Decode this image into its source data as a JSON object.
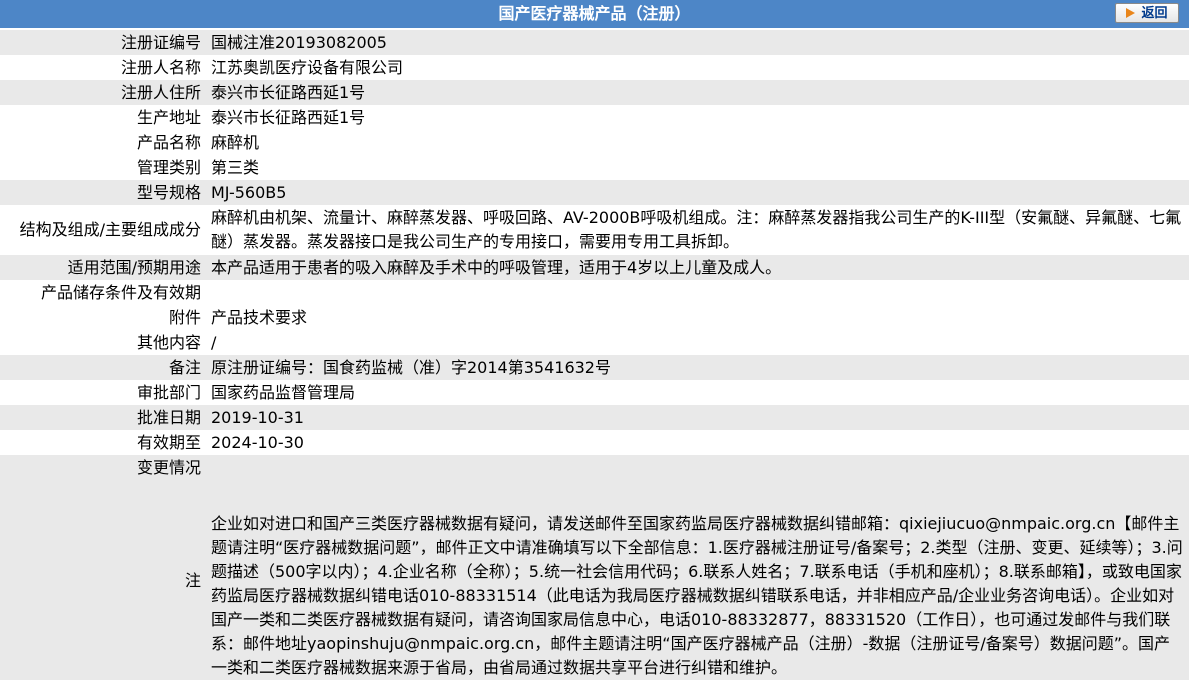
{
  "header": {
    "title": "国产医疗器械产品（注册）",
    "back_label": "返回"
  },
  "rows": [
    {
      "label": "注册证编号",
      "value": "国械注准20193082005"
    },
    {
      "label": "注册人名称",
      "value": "江苏奥凯医疗设备有限公司"
    },
    {
      "label": "注册人住所",
      "value": "泰兴市长征路西延1号"
    },
    {
      "label": "生产地址",
      "value": "泰兴市长征路西延1号"
    },
    {
      "label": "产品名称",
      "value": "麻醉机"
    },
    {
      "label": "管理类别",
      "value": "第三类"
    },
    {
      "label": "型号规格",
      "value": "MJ-560B5"
    },
    {
      "label": "结构及组成/主要组成成分",
      "value": "麻醉机由机架、流量计、麻醉蒸发器、呼吸回路、AV-2000B呼吸机组成。注：麻醉蒸发器指我公司生产的K-III型（安氟醚、异氟醚、七氟醚）蒸发器。蒸发器接口是我公司生产的专用接口，需要用专用工具拆卸。"
    },
    {
      "label": "适用范围/预期用途",
      "value": "本产品适用于患者的吸入麻醉及手术中的呼吸管理，适用于4岁以上儿童及成人。"
    },
    {
      "label": "产品储存条件及有效期",
      "value": ""
    },
    {
      "label": "附件",
      "value": "产品技术要求"
    },
    {
      "label": "其他内容",
      "value": "/"
    },
    {
      "label": "备注",
      "value": "原注册证编号：国食药监械（准）字2014第3541632号"
    },
    {
      "label": "审批部门",
      "value": "国家药品监督管理局"
    },
    {
      "label": "批准日期",
      "value": "2019-10-31"
    },
    {
      "label": "有效期至",
      "value": "2024-10-30"
    },
    {
      "label": "变更情况",
      "value": ""
    }
  ],
  "note": {
    "label": "注",
    "text": "企业如对进口和国产三类医疗器械数据有疑问，请发送邮件至国家药监局医疗器械数据纠错邮箱：qixiejiucuo@nmpaic.org.cn【邮件主题请注明“医疗器械数据问题”，邮件正文中请准确填写以下全部信息：1.医疗器械注册证号/备案号；2.类型（注册、变更、延续等）；3.问题描述（500字以内）；4.企业名称（全称）；5.统一社会信用代码；6.联系人姓名；7.联系电话（手机和座机）；8.联系邮箱】，或致电国家药监局医疗器械数据纠错电话010-88331514（此电话为我局医疗器械数据纠错联系电话，并非相应产品/企业业务咨询电话）。企业如对国产一类和二类医疗器械数据有疑问，请咨询国家局信息中心，电话010-88332877，88331520（工作日），也可通过发邮件与我们联系：邮件地址yaopinshuju@nmpaic.org.cn，邮件主题请注明“国产医疗器械产品（注册）-数据（注册证号/备案号）数据问题”。国产一类和二类医疗器械数据来源于省局，由省局通过数据共享平台进行纠错和维护。"
  },
  "colors": {
    "header_bg": "#4d86c7",
    "row_shade": "#e9e9e9",
    "row_white": "#ffffff",
    "back_arrow": "#e9861c"
  }
}
